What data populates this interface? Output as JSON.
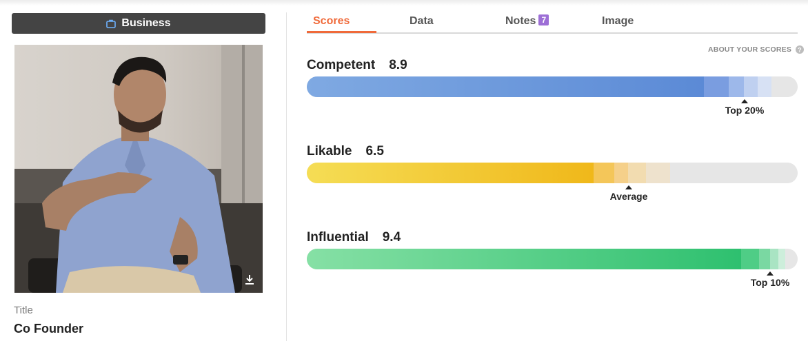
{
  "profile": {
    "category": "Business",
    "category_icon": "briefcase-icon",
    "title_label": "Title",
    "title_value": "Co Founder"
  },
  "tabs": [
    {
      "label": "Scores",
      "active": true
    },
    {
      "label": "Data"
    },
    {
      "label": "Notes",
      "badge": "7"
    },
    {
      "label": "Image"
    }
  ],
  "about_link": "ABOUT YOUR SCORES",
  "scores": [
    {
      "label": "Competent",
      "value": "8.9",
      "percentile_label": "Top 20%",
      "color": "#5b8ad6"
    },
    {
      "label": "Likable",
      "value": "6.5",
      "percentile_label": "Average",
      "color": "#f0b81a"
    },
    {
      "label": "Influential",
      "value": "9.4",
      "percentile_label": "Top 10%",
      "color": "#2ec06f"
    }
  ],
  "colors": {
    "accent": "#f06a3a",
    "badge": "#9d6fd6",
    "category_bg": "#444444"
  }
}
